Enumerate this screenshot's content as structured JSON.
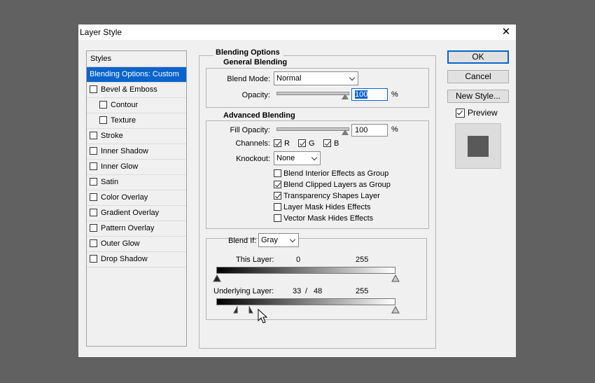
{
  "window": {
    "title": "Layer Style"
  },
  "styles_panel": {
    "header": "Styles",
    "items": [
      {
        "label": "Blending Options: Custom",
        "selected": true
      },
      {
        "label": "Bevel & Emboss",
        "checked": false
      },
      {
        "label": "Contour",
        "checked": false
      },
      {
        "label": "Texture",
        "checked": false
      },
      {
        "label": "Stroke",
        "checked": false
      },
      {
        "label": "Inner Shadow",
        "checked": false
      },
      {
        "label": "Inner Glow",
        "checked": false
      },
      {
        "label": "Satin",
        "checked": false
      },
      {
        "label": "Color Overlay",
        "checked": false
      },
      {
        "label": "Gradient Overlay",
        "checked": false
      },
      {
        "label": "Pattern Overlay",
        "checked": false
      },
      {
        "label": "Outer Glow",
        "checked": false
      },
      {
        "label": "Drop Shadow",
        "checked": false
      }
    ]
  },
  "blending": {
    "title": "Blending Options",
    "general": {
      "title": "General Blending",
      "blend_mode_label": "Blend Mode:",
      "blend_mode": "Normal",
      "opacity_label": "Opacity:",
      "opacity": "100",
      "unit": "%"
    },
    "advanced": {
      "title": "Advanced Blending",
      "fill_opacity_label": "Fill Opacity:",
      "fill_opacity": "100",
      "unit": "%",
      "channels_label": "Channels:",
      "channels": [
        {
          "label": "R",
          "checked": true
        },
        {
          "label": "G",
          "checked": true
        },
        {
          "label": "B",
          "checked": true
        }
      ],
      "knockout_label": "Knockout:",
      "knockout": "None",
      "options": [
        {
          "label": "Blend Interior Effects as Group",
          "checked": false
        },
        {
          "label": "Blend Clipped Layers as Group",
          "checked": true
        },
        {
          "label": "Transparency Shapes Layer",
          "checked": true
        },
        {
          "label": "Layer Mask Hides Effects",
          "checked": false
        },
        {
          "label": "Vector Mask Hides Effects",
          "checked": false
        }
      ]
    },
    "blend_if": {
      "label": "Blend If:",
      "value": "Gray",
      "this_layer_label": "This Layer:",
      "this_layer_low": "0",
      "this_layer_high": "255",
      "underlying_label": "Underlying Layer:",
      "underlying_low": "33",
      "underlying_sep": "/",
      "underlying_low2": "48",
      "underlying_high": "255"
    }
  },
  "buttons": {
    "ok": "OK",
    "cancel": "Cancel",
    "new_style": "New Style..."
  },
  "preview": {
    "label": "Preview",
    "checked": true
  }
}
